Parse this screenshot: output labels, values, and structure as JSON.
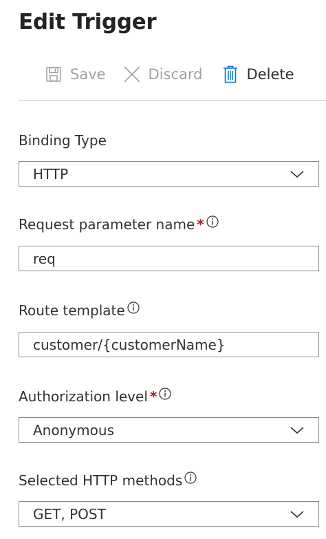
{
  "panel": {
    "title": "Edit Trigger"
  },
  "toolbar": {
    "save_label": "Save",
    "discard_label": "Discard",
    "delete_label": "Delete"
  },
  "fields": {
    "binding_type": {
      "label": "Binding Type",
      "value": "HTTP"
    },
    "request_parameter_name": {
      "label": "Request parameter name",
      "required_mark": "*",
      "value": "req"
    },
    "route_template": {
      "label": "Route template",
      "value": "customer/{customerName}"
    },
    "authorization_level": {
      "label": "Authorization level",
      "required_mark": "*",
      "value": "Anonymous"
    },
    "http_methods": {
      "label": "Selected HTTP methods",
      "value": "GET, POST"
    }
  },
  "icons": {
    "save": "save-icon",
    "discard": "close-icon",
    "delete": "trash-icon",
    "info": "info-icon",
    "dropdown": "chevron-down-icon"
  },
  "colors": {
    "required": "#a4262c",
    "delete_icon": "#0078d4",
    "disabled_text": "#a19f9d"
  }
}
